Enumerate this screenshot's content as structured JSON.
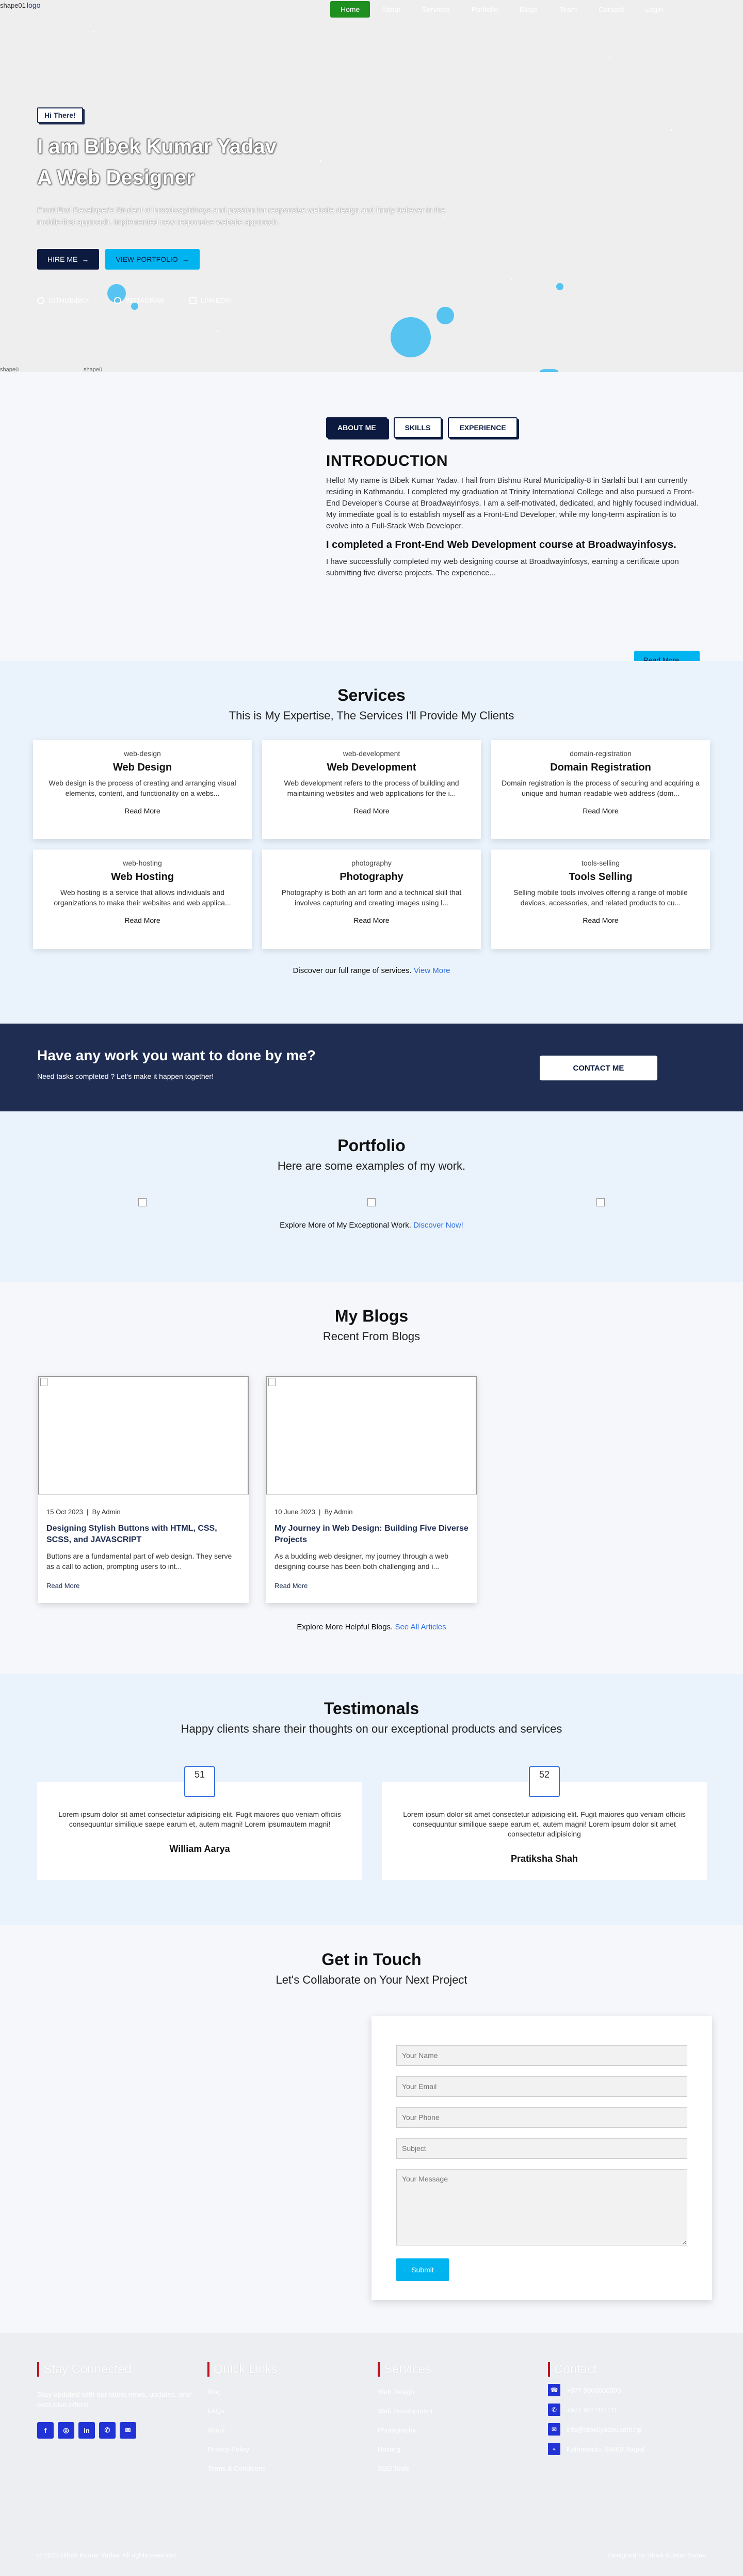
{
  "header": {
    "logo_img1_alt": "shape01",
    "logo_img2_alt": "logo",
    "nav": [
      "Home",
      "About",
      "Services",
      "Portfolio",
      "Blogs",
      "Team",
      "Contact",
      "Login"
    ]
  },
  "hero": {
    "tag": "Hi There!",
    "title_line1": "I am Bibek Kumar Yadav",
    "title_line2": "A  Web Designer",
    "description": "Front End Developer's Student of broadwayinfosys and passion for responsive website design and firmly believer in the mobile-first approach. Implemented new responsive website approach.",
    "hire_label": "HIRE ME",
    "portfolio_label": "VIEW PORTFOLIO",
    "stats": [
      "GITHUB/BKY",
      "INSTAGRAM",
      "LINKEDIN"
    ],
    "broken_img1": "shape0",
    "broken_img2": "shape0"
  },
  "about": {
    "tabs": [
      "ABOUT ME",
      "SKILLS",
      "EXPERIENCE"
    ],
    "heading": "INTRODUCTION",
    "para1": "Hello! My name is Bibek Kumar Yadav. I hail from Bishnu Rural Municipality-8 in Sarlahi but I am currently residing in Kathmandu. I completed my graduation at Trinity International College and also pursued a Front-End Developer's Course at Broadwayinfosys. I am a self-motivated, dedicated, and highly focused individual. My immediate goal is to establish myself as a Front-End Developer, while my long-term aspiration is to evolve into a Full-Stack Web Developer.",
    "subheading": "I completed a Front-End Web Development course at Broadwayinfosys.",
    "para2": "I have successfully completed my web designing course at Broadwayinfosys, earning a certificate upon submitting five diverse projects. The experience...",
    "read_more": "Read More"
  },
  "services": {
    "title": "Services",
    "subtitle": "This is My Expertise, The Services I'll Provide My Clients",
    "items": [
      {
        "img": "web-design",
        "name": "Web Design",
        "desc": "Web design is the process of creating and arranging visual elements, content, and functionality on a webs...",
        "more": "Read More"
      },
      {
        "img": "web-development",
        "name": "Web Development",
        "desc": "Web development refers to the process of building and maintaining websites and web applications for the i...",
        "more": "Read More"
      },
      {
        "img": "domain-registration",
        "name": "Domain Registration",
        "desc": "Domain registration is the process of securing and acquiring a unique and human-readable web address (dom...",
        "more": "Read More"
      },
      {
        "img": "web-hosting",
        "name": "Web Hosting",
        "desc": "Web hosting is a service that allows individuals and organizations to make their websites and web applica...",
        "more": "Read More"
      },
      {
        "img": "photography",
        "name": "Photography",
        "desc": "Photography is both an art form and a technical skill that involves capturing and creating images using l...",
        "more": "Read More"
      },
      {
        "img": "tools-selling",
        "name": "Tools Selling",
        "desc": "Selling mobile tools involves offering a range of mobile devices, accessories, and related products to cu...",
        "more": "Read More"
      }
    ],
    "footer_text": "Discover our full range of services.",
    "footer_link": "View More"
  },
  "cta": {
    "heading": "Have any work you want to done by me?",
    "sub": "Need tasks completed ? Let's make it happen together!",
    "button": "CONTACT ME"
  },
  "portfolio": {
    "title": "Portfolio",
    "subtitle": "Here are some examples of my work.",
    "footer_text": "Explore More of My Exceptional Work.",
    "footer_link": "Discover Now!"
  },
  "blogs": {
    "title": "My Blogs",
    "subtitle": "Recent From Blogs",
    "items": [
      {
        "date": "15 Oct 2023",
        "author": "By Admin",
        "title": "Designing Stylish Buttons with HTML, CSS, SCSS, and JAVASCRIPT",
        "excerpt": "Buttons are a fundamental part of web design. They serve as a call to action, prompting users to int...",
        "more": "Read More"
      },
      {
        "date": "10 June 2023",
        "author": "By Admin",
        "title": "My Journey in Web Design: Building Five Diverse Projects",
        "excerpt": "As a budding web designer, my journey through a web designing course has been both challenging and i...",
        "more": "Read More"
      }
    ],
    "footer_text": "Explore More Helpful Blogs.",
    "footer_link": "See All Articles"
  },
  "testimonials": {
    "title": "Testimonals",
    "subtitle": "Happy clients share their thoughts on our exceptional products and services",
    "items": [
      {
        "avatar": "51",
        "text": "Lorem ipsum dolor sit amet consectetur adipisicing elit. Fugit maiores quo veniam officiis consequuntur similique saepe earum et, autem magni! Lorem ipsumautem magni!",
        "name": "William Aarya"
      },
      {
        "avatar": "52",
        "text": "Lorem ipsum dolor sit amet consectetur adipisicing elit. Fugit maiores quo veniam officiis consequuntur similique saepe earum et, autem magni! Lorem ipsum dolor sit amet consectetur adipisicing",
        "name": "Pratiksha Shah"
      }
    ]
  },
  "contact": {
    "title": "Get in Touch",
    "subtitle": "Let's Collaborate on Your Next Project",
    "placeholders": [
      "Your Name",
      "Your Email",
      "Your Phone",
      "Subject",
      "Your Message"
    ],
    "submit": "Submit"
  },
  "footer": {
    "col1_title": "Stay Connected",
    "col1_text": "Stay updated with our latest news, updates, and exclusive offers!",
    "col2_title": "Quick Links",
    "col2_items": [
      "Blog",
      "FAQs",
      "About",
      "Privacy Policy",
      "Terms & Conditions"
    ],
    "col3_title": "Services",
    "col3_items": [
      "Web Design",
      "Web Development",
      "Photography",
      "Hosting",
      "SEO Tools"
    ],
    "col4_title": "Contact",
    "contact_items": [
      {
        "icon": "phone-icon",
        "glyph": "☎",
        "text": "+977 9800000000"
      },
      {
        "icon": "mobile-icon",
        "glyph": "✆",
        "text": "+977 9811111111"
      },
      {
        "icon": "email-icon",
        "glyph": "✉",
        "text": "info@bibekyadav.com.np"
      },
      {
        "icon": "location-icon",
        "glyph": "⌖",
        "text": "Kathmandu, 44600, Nepal"
      }
    ],
    "socials": [
      {
        "icon": "facebook-icon",
        "glyph": "f"
      },
      {
        "icon": "instagram-icon",
        "glyph": "◎"
      },
      {
        "icon": "linkedin-icon",
        "glyph": "in"
      },
      {
        "icon": "whatsapp-icon",
        "glyph": "✆"
      },
      {
        "icon": "mail-icon",
        "glyph": "✉"
      }
    ],
    "copyright": "© 2023 Bibek Kumar Yadav. All rights reserved.",
    "credits": "Designed by Bibek Kumar Yadav"
  }
}
